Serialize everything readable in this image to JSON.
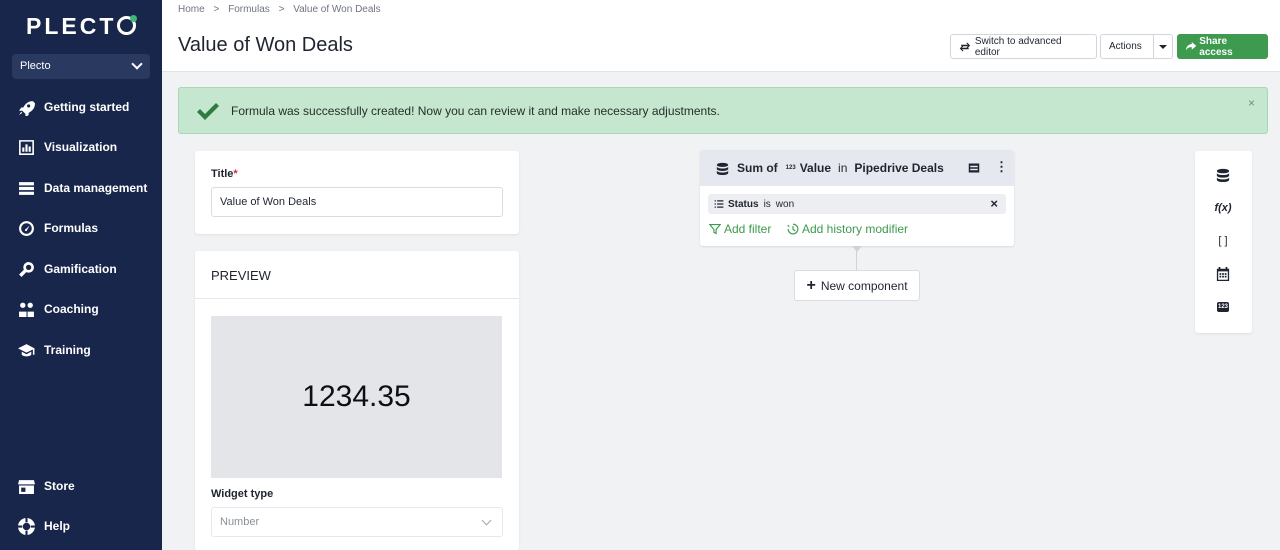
{
  "sidebar": {
    "logo": "PLECT",
    "org": "Plecto",
    "items": [
      {
        "label": "Getting started",
        "icon": "rocket-icon"
      },
      {
        "label": "Visualization",
        "icon": "chart-icon"
      },
      {
        "label": "Data management",
        "icon": "database-icon"
      },
      {
        "label": "Formulas",
        "icon": "gauge-icon"
      },
      {
        "label": "Gamification",
        "icon": "gamepad-icon"
      },
      {
        "label": "Coaching",
        "icon": "people-icon"
      },
      {
        "label": "Training",
        "icon": "graduation-cap-icon"
      },
      {
        "label": "Store",
        "icon": "store-icon"
      },
      {
        "label": "Help",
        "icon": "lifebuoy-icon"
      }
    ]
  },
  "breadcrumb": {
    "home": "Home",
    "sep": ">",
    "formulas": "Formulas",
    "current": "Value of Won Deals"
  },
  "header": {
    "title": "Value of Won Deals",
    "switch_label": "Switch to advanced editor",
    "actions_label": "Actions",
    "share_label": "Share access"
  },
  "alert": {
    "message": "Formula was successfully created! Now you can review it and make necessary adjustments.",
    "close": "×"
  },
  "form": {
    "title_label": "Title",
    "required_mark": "*",
    "title_value": "Value of Won Deals",
    "preview_heading": "PREVIEW",
    "preview_value": "1234.35",
    "widget_type_label": "Widget type",
    "widget_type_value": "Number"
  },
  "component": {
    "sum_of": "Sum of",
    "field_badge": "123",
    "field": "Value",
    "in": "in",
    "source": "Pipedrive Deals",
    "filter_field": "Status",
    "filter_op": "is",
    "filter_value": "won",
    "add_filter": "Add filter",
    "add_history": "Add history modifier",
    "new_component": "New component"
  },
  "toolbox": {
    "fx": "f(x)",
    "brackets": "[ ]",
    "num": "123"
  },
  "colors": {
    "sidebar": "#17264a",
    "accent": "#3d9a4e",
    "alert_bg": "#c5e6cf"
  }
}
